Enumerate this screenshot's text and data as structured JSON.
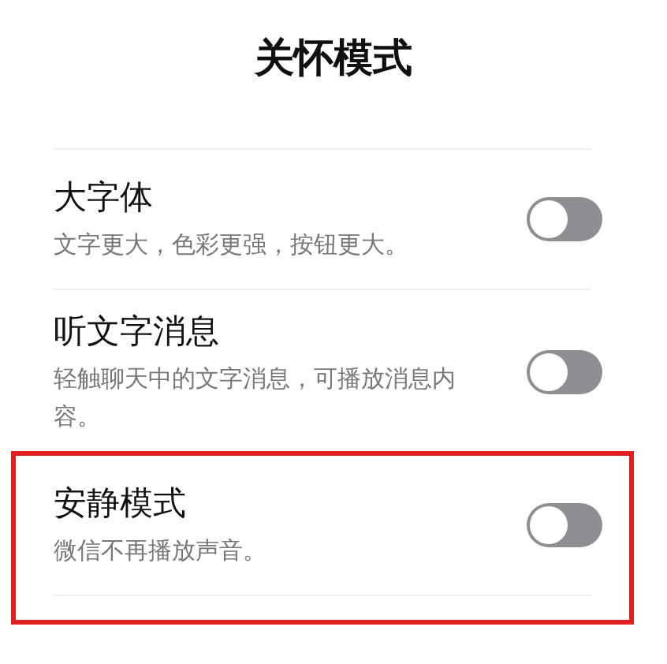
{
  "title": "关怀模式",
  "settings": [
    {
      "label": "大字体",
      "description": "文字更大，色彩更强，按钮更大。",
      "on": false,
      "highlighted": false
    },
    {
      "label": "听文字消息",
      "description": "轻触聊天中的文字消息，可播放消息内容。",
      "on": false,
      "highlighted": false
    },
    {
      "label": "安静模式",
      "description": "微信不再播放声音。",
      "on": false,
      "highlighted": true
    }
  ]
}
